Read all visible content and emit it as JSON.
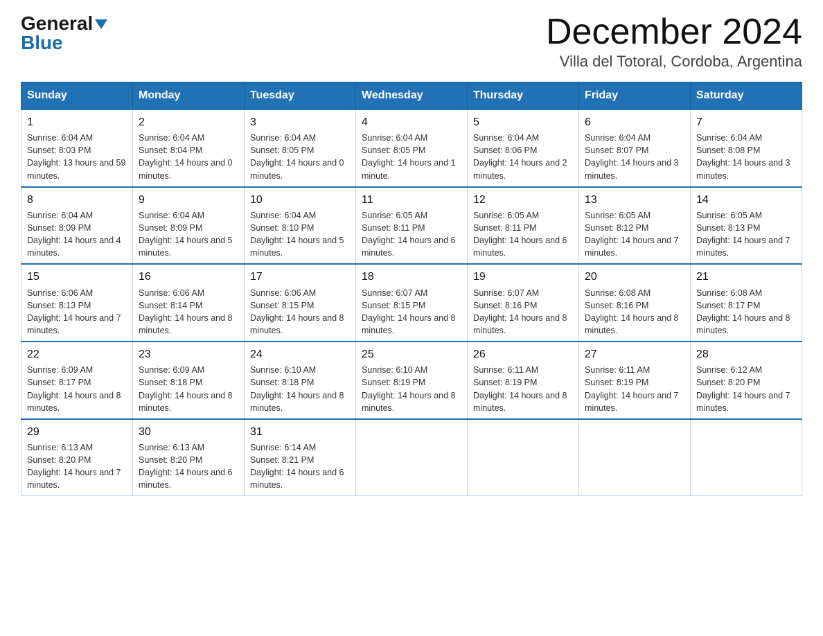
{
  "header": {
    "logo_general": "General",
    "logo_blue": "Blue",
    "month_title": "December 2024",
    "subtitle": "Villa del Totoral, Cordoba, Argentina"
  },
  "days_of_week": [
    "Sunday",
    "Monday",
    "Tuesday",
    "Wednesday",
    "Thursday",
    "Friday",
    "Saturday"
  ],
  "weeks": [
    [
      {
        "day": "1",
        "sunrise": "6:04 AM",
        "sunset": "8:03 PM",
        "daylight": "13 hours and 59 minutes."
      },
      {
        "day": "2",
        "sunrise": "6:04 AM",
        "sunset": "8:04 PM",
        "daylight": "14 hours and 0 minutes."
      },
      {
        "day": "3",
        "sunrise": "6:04 AM",
        "sunset": "8:05 PM",
        "daylight": "14 hours and 0 minutes."
      },
      {
        "day": "4",
        "sunrise": "6:04 AM",
        "sunset": "8:05 PM",
        "daylight": "14 hours and 1 minute."
      },
      {
        "day": "5",
        "sunrise": "6:04 AM",
        "sunset": "8:06 PM",
        "daylight": "14 hours and 2 minutes."
      },
      {
        "day": "6",
        "sunrise": "6:04 AM",
        "sunset": "8:07 PM",
        "daylight": "14 hours and 3 minutes."
      },
      {
        "day": "7",
        "sunrise": "6:04 AM",
        "sunset": "8:08 PM",
        "daylight": "14 hours and 3 minutes."
      }
    ],
    [
      {
        "day": "8",
        "sunrise": "6:04 AM",
        "sunset": "8:09 PM",
        "daylight": "14 hours and 4 minutes."
      },
      {
        "day": "9",
        "sunrise": "6:04 AM",
        "sunset": "8:09 PM",
        "daylight": "14 hours and 5 minutes."
      },
      {
        "day": "10",
        "sunrise": "6:04 AM",
        "sunset": "8:10 PM",
        "daylight": "14 hours and 5 minutes."
      },
      {
        "day": "11",
        "sunrise": "6:05 AM",
        "sunset": "8:11 PM",
        "daylight": "14 hours and 6 minutes."
      },
      {
        "day": "12",
        "sunrise": "6:05 AM",
        "sunset": "8:11 PM",
        "daylight": "14 hours and 6 minutes."
      },
      {
        "day": "13",
        "sunrise": "6:05 AM",
        "sunset": "8:12 PM",
        "daylight": "14 hours and 7 minutes."
      },
      {
        "day": "14",
        "sunrise": "6:05 AM",
        "sunset": "8:13 PM",
        "daylight": "14 hours and 7 minutes."
      }
    ],
    [
      {
        "day": "15",
        "sunrise": "6:06 AM",
        "sunset": "8:13 PM",
        "daylight": "14 hours and 7 minutes."
      },
      {
        "day": "16",
        "sunrise": "6:06 AM",
        "sunset": "8:14 PM",
        "daylight": "14 hours and 8 minutes."
      },
      {
        "day": "17",
        "sunrise": "6:06 AM",
        "sunset": "8:15 PM",
        "daylight": "14 hours and 8 minutes."
      },
      {
        "day": "18",
        "sunrise": "6:07 AM",
        "sunset": "8:15 PM",
        "daylight": "14 hours and 8 minutes."
      },
      {
        "day": "19",
        "sunrise": "6:07 AM",
        "sunset": "8:16 PM",
        "daylight": "14 hours and 8 minutes."
      },
      {
        "day": "20",
        "sunrise": "6:08 AM",
        "sunset": "8:16 PM",
        "daylight": "14 hours and 8 minutes."
      },
      {
        "day": "21",
        "sunrise": "6:08 AM",
        "sunset": "8:17 PM",
        "daylight": "14 hours and 8 minutes."
      }
    ],
    [
      {
        "day": "22",
        "sunrise": "6:09 AM",
        "sunset": "8:17 PM",
        "daylight": "14 hours and 8 minutes."
      },
      {
        "day": "23",
        "sunrise": "6:09 AM",
        "sunset": "8:18 PM",
        "daylight": "14 hours and 8 minutes."
      },
      {
        "day": "24",
        "sunrise": "6:10 AM",
        "sunset": "8:18 PM",
        "daylight": "14 hours and 8 minutes."
      },
      {
        "day": "25",
        "sunrise": "6:10 AM",
        "sunset": "8:19 PM",
        "daylight": "14 hours and 8 minutes."
      },
      {
        "day": "26",
        "sunrise": "6:11 AM",
        "sunset": "8:19 PM",
        "daylight": "14 hours and 8 minutes."
      },
      {
        "day": "27",
        "sunrise": "6:11 AM",
        "sunset": "8:19 PM",
        "daylight": "14 hours and 7 minutes."
      },
      {
        "day": "28",
        "sunrise": "6:12 AM",
        "sunset": "8:20 PM",
        "daylight": "14 hours and 7 minutes."
      }
    ],
    [
      {
        "day": "29",
        "sunrise": "6:13 AM",
        "sunset": "8:20 PM",
        "daylight": "14 hours and 7 minutes."
      },
      {
        "day": "30",
        "sunrise": "6:13 AM",
        "sunset": "8:20 PM",
        "daylight": "14 hours and 6 minutes."
      },
      {
        "day": "31",
        "sunrise": "6:14 AM",
        "sunset": "8:21 PM",
        "daylight": "14 hours and 6 minutes."
      },
      null,
      null,
      null,
      null
    ]
  ]
}
